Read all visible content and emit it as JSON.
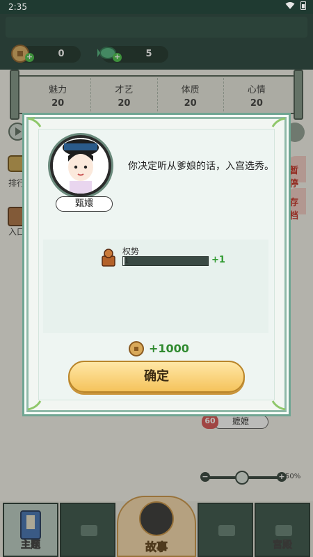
{
  "status_bar": {
    "time": "2:35"
  },
  "resources": [
    {
      "icon": "coin-icon",
      "value": "0"
    },
    {
      "icon": "jade-fish-icon",
      "value": "5"
    }
  ],
  "stats": [
    {
      "name": "魅力",
      "value": "20"
    },
    {
      "name": "才艺",
      "value": "20"
    },
    {
      "name": "体质",
      "value": "20"
    },
    {
      "name": "心情",
      "value": "20"
    }
  ],
  "background": {
    "left_items": [
      "排行",
      "入口"
    ],
    "right_items": [
      "暂停",
      "存档"
    ],
    "character_heart": "60",
    "character_name": "嬷嬷",
    "slider_percent": "50%"
  },
  "bottom_nav": {
    "left": "主题",
    "center": "故事",
    "right": "宫殿"
  },
  "dialog": {
    "character_name": "甄嬛",
    "story_text": "你决定听从爹娘的话，入宫选秀。",
    "attribute_label": "权势",
    "attribute_value": "1",
    "attribute_progress": 0.02,
    "attribute_change": "+1",
    "coin_reward": "+1000",
    "confirm_label": "确定"
  },
  "colors": {
    "header_bg": "#1d3b33",
    "dialog_border": "#6fa592",
    "confirm_bg": "#f5c35c",
    "positive_green": "#2f9a2f"
  }
}
